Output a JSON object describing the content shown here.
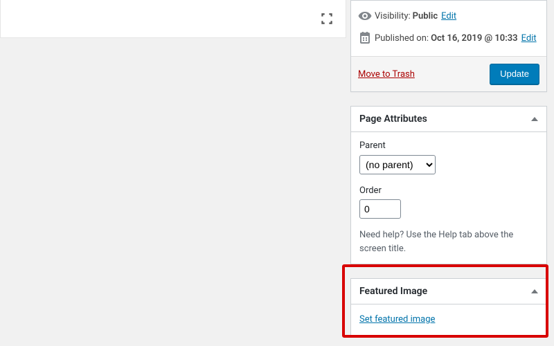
{
  "publish": {
    "visibility_label": "Visibility:",
    "visibility_value": "Public",
    "visibility_edit": "Edit",
    "published_label": "Published on:",
    "published_value": "Oct 16, 2019 @ 10:33",
    "published_edit": "Edit",
    "trash": "Move to Trash",
    "update": "Update"
  },
  "page_attributes": {
    "title": "Page Attributes",
    "parent_label": "Parent",
    "parent_value": "(no parent)",
    "order_label": "Order",
    "order_value": "0",
    "help": "Need help? Use the Help tab above the screen title."
  },
  "featured_image": {
    "title": "Featured Image",
    "set_link": "Set featured image"
  }
}
